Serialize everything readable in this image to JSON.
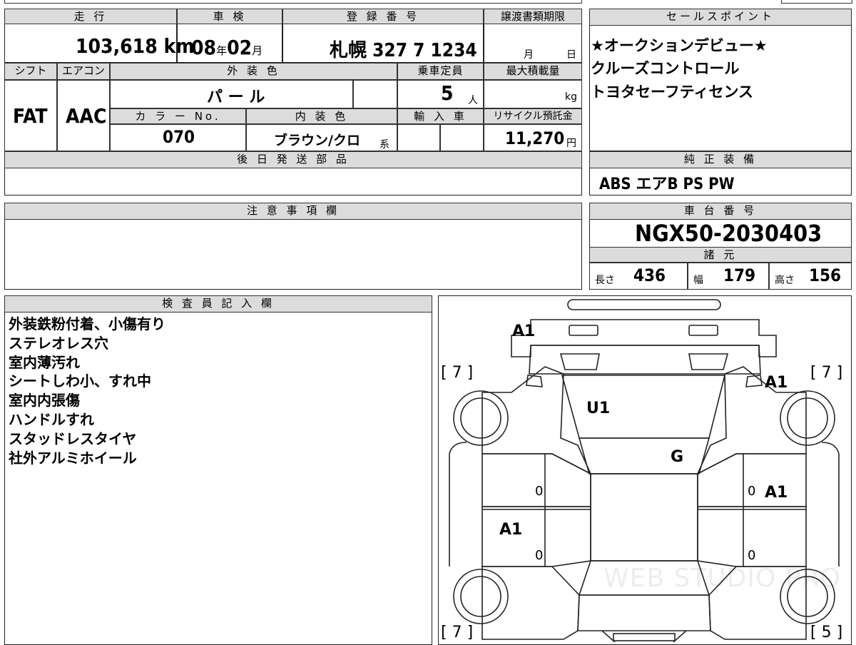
{
  "top": {
    "mileage_label": "走 行",
    "mileage_value": "103,618",
    "mileage_unit": "km",
    "inspection_label": "車 検",
    "inspection_year": "08",
    "year_unit": "年",
    "inspection_month": "02",
    "month_unit": "月",
    "registration_label": "登 録 番 号",
    "registration_value": "札幌 327 7 1234",
    "transfer_label": "譲渡書類期限",
    "transfer_month": "月",
    "transfer_day": "日"
  },
  "row2": {
    "shift_label": "シフト",
    "shift_value": "FAT",
    "ac_label": "エアコン",
    "ac_value": "AAC",
    "exterior_label": "外 装 色",
    "exterior_value": "パ ー ル",
    "capacity_label": "乗車定員",
    "capacity_value": "5",
    "capacity_unit": "人",
    "max_load_label": "最大積載量",
    "max_load_unit": "kg",
    "color_no_label": "カ ラ ー No.",
    "color_no_value": "070",
    "interior_label": "内 装 色",
    "interior_value": "ブラウン/クロ",
    "interior_suffix": "系",
    "import_label": "輸 入 車",
    "recycle_label": "リサイクル預託金",
    "recycle_value": "11,270",
    "recycle_unit": "円",
    "later_parts_label": "後 日 発 送 部 品"
  },
  "sales": {
    "label": "セールスポイント",
    "lines": [
      "★オークションデビュー★",
      "クルーズコントロール",
      "トヨタセーフティセンス"
    ]
  },
  "equipment": {
    "label": "純 正 装 備",
    "value": "ABS エアB PS PW"
  },
  "notes": {
    "label": "注 意 事 項 欄"
  },
  "chassis": {
    "label": "車 台 番 号",
    "value": "NGX50-2030403"
  },
  "specs": {
    "label": "諸 元",
    "length_label": "長さ",
    "length_value": "436",
    "width_label": "幅",
    "width_value": "179",
    "height_label": "高さ",
    "height_value": "156"
  },
  "inspector": {
    "label": "検 査 員 記 入 欄",
    "lines": [
      "外装鉄粉付着、小傷有り",
      "ステレオレス穴",
      "室内薄汚れ",
      "シートしわ小、すれ中",
      "室内内張傷",
      "ハンドルすれ",
      "スタッドレスタイヤ",
      "社外アルミホイール"
    ]
  },
  "diagram": {
    "tire_fl": "[ 7 ]",
    "tire_fr": "[ 7 ]",
    "tire_rl": "[ 7 ]",
    "tire_rr": "[ 5 ]",
    "mark_front": "A1",
    "mark_front_right": "A1",
    "mark_windshield": "U1",
    "mark_roof": "G",
    "mark_right_door": "A1",
    "mark_left_rear_door": "A1",
    "zero_1": "0",
    "zero_2": "0",
    "zero_3": "0",
    "zero_4": "0",
    "watermark": "WEB STUDIO PRO"
  }
}
